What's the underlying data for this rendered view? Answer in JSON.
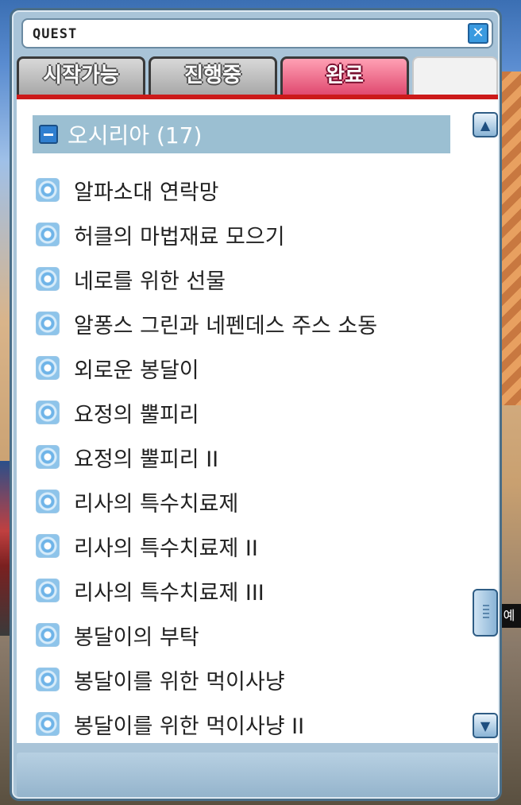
{
  "window": {
    "title": "QUEST",
    "close_icon": "close-icon"
  },
  "tabs": [
    {
      "label": "시작가능",
      "state": "inactive"
    },
    {
      "label": "진행중",
      "state": "inactive"
    },
    {
      "label": "완료",
      "state": "active"
    }
  ],
  "group": {
    "title": "오시리아 (17)",
    "expanded": true
  },
  "quests": [
    "알파소대 연락망",
    "허클의 마법재료 모으기",
    "네로를 위한 선물",
    "알퐁스 그린과 네펜데스 주스 소동",
    "외로운 봉달이",
    "요정의 뿔피리",
    "요정의 뿔피리 II",
    "리사의 특수치료제",
    "리사의 특수치료제 II",
    "리사의 특수치료제 III",
    "봉달이의 부탁",
    "봉달이를 위한 먹이사냥",
    "봉달이를 위한 먹이사냥 II"
  ],
  "background_sign": "예",
  "colors": {
    "active_tab": "#e04a70",
    "tab_underline": "#cc1a1a",
    "group_header": "#9bbfd2",
    "window_frame": "#a9c4d8"
  }
}
